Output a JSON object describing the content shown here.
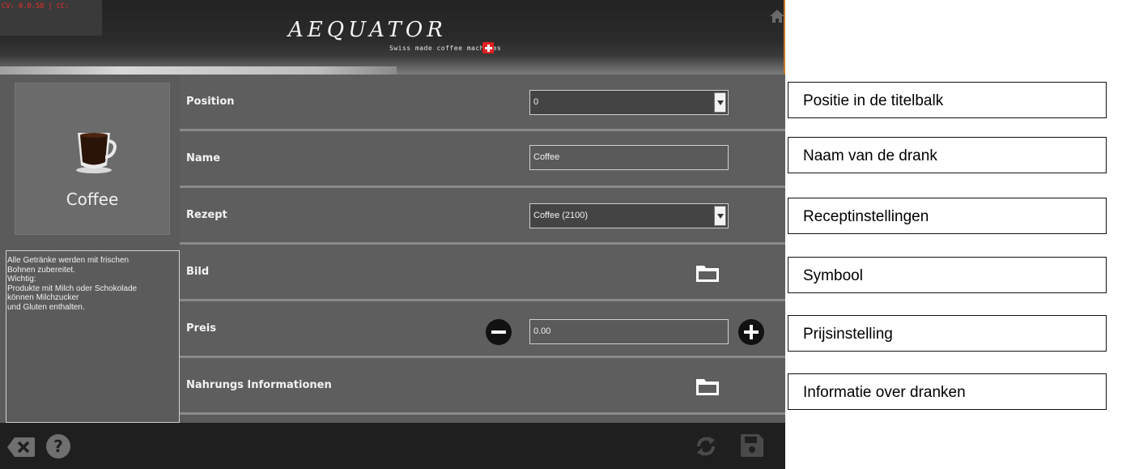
{
  "header": {
    "status_text": "CV: 0.0.58 | CC:",
    "logo_text": "AEQUATOR",
    "logo_tagline": "Swiss made coffee machines",
    "home_icon": "home-icon"
  },
  "preview": {
    "product_name": "Coffee",
    "image_icon": "coffee-cup-icon"
  },
  "info_text": "Alle Getränke werden mit frischen\nBohnen zubereitet.\nWichtig:\nProdukte mit Milch oder Schokolade\nkönnen Milchzucker\nund Gluten enthalten.",
  "settings": {
    "position": {
      "label": "Position",
      "value": "0"
    },
    "name": {
      "label": "Name",
      "value": "Coffee"
    },
    "rezept": {
      "label": "Rezept",
      "value": "Coffee (2100)"
    },
    "bild": {
      "label": "Bild",
      "icon": "folder-icon"
    },
    "preis": {
      "label": "Preis",
      "value": "0.00",
      "decrease_icon": "minus-circle-icon",
      "increase_icon": "plus-circle-icon"
    },
    "nahrung": {
      "label": "Nahrungs Informationen",
      "icon": "folder-icon"
    }
  },
  "footer": {
    "left_icons": [
      "backspace-icon",
      "help-icon"
    ],
    "right_icons": [
      "refresh-icon",
      "save-icon"
    ]
  },
  "annotations": [
    "Positie in de titelbalk",
    "Naam van de drank",
    "Receptinstellingen",
    "Symbool",
    "Prijsinstelling",
    "Informatie over dranken"
  ],
  "colors": {
    "status_text": "#e53030",
    "swiss_flag": "#e02020",
    "panel_bg": "#5b5b5b",
    "footer_bg": "#1f1f1f"
  }
}
